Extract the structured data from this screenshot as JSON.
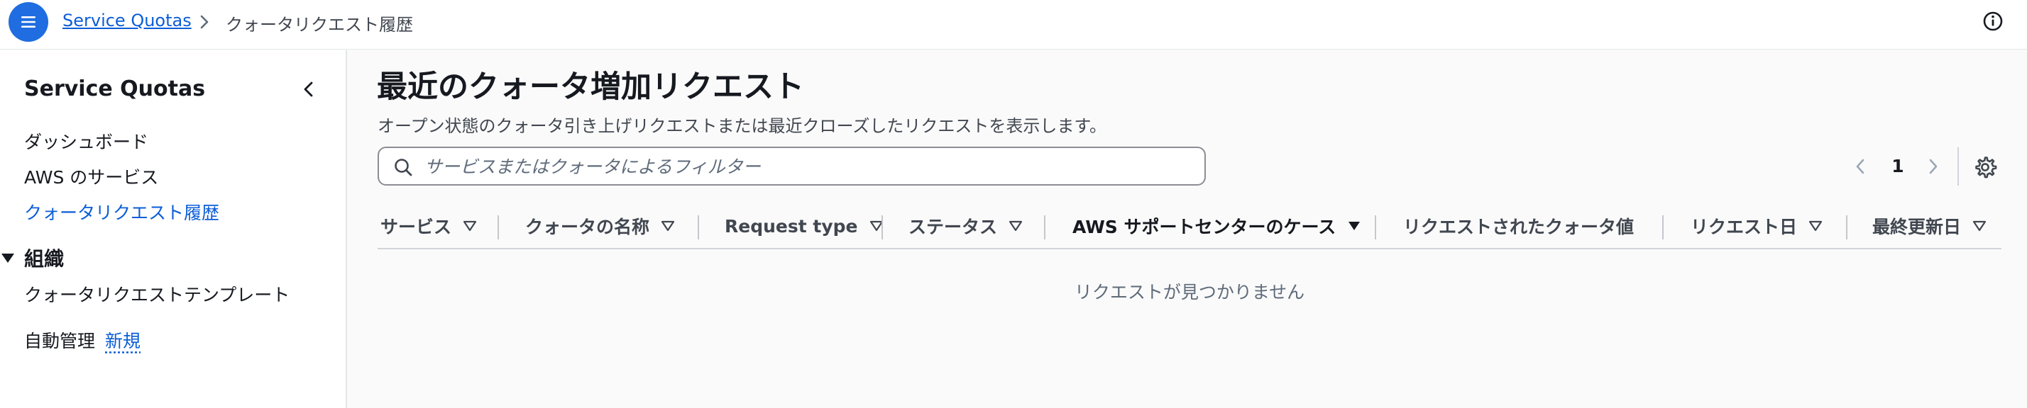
{
  "breadcrumb": {
    "root": "Service Quotas",
    "current": "クォータリクエスト履歴"
  },
  "sidebar": {
    "title": "Service Quotas",
    "items": [
      {
        "label": "ダッシュボード"
      },
      {
        "label": "AWS のサービス"
      },
      {
        "label": "クォータリクエスト履歴",
        "active": true
      }
    ],
    "group": {
      "label": "組織",
      "items": [
        {
          "label": "クォータリクエストテンプレート"
        },
        {
          "label": "自動管理",
          "badge": "新規"
        }
      ]
    }
  },
  "main": {
    "title": "最近のクォータ増加リクエスト",
    "description": "オープン状態のクォータ引き上げリクエストまたは最近クローズしたリクエストを表示します。",
    "search": {
      "placeholder": "サービスまたはクォータによるフィルター",
      "value": ""
    },
    "pagination": {
      "current_page": "1"
    },
    "table": {
      "columns": [
        {
          "label": "サービス"
        },
        {
          "label": "クォータの名称"
        },
        {
          "label": "Request type"
        },
        {
          "label": "ステータス"
        },
        {
          "label": "AWS サポートセンターのケース",
          "sorted": true
        },
        {
          "label": "リクエストされたクォータ値"
        },
        {
          "label": "リクエスト日"
        },
        {
          "label": "最終更新日"
        }
      ],
      "empty_message": "リクエストが見つかりません"
    }
  },
  "icons": {
    "menu": "hamburger-icon",
    "breadcrumb_separator": "chevron-right-icon",
    "info": "info-icon",
    "collapse": "chevron-left-icon",
    "group_toggle": "caret-down-icon",
    "search": "search-icon",
    "prev": "chevron-left-icon",
    "next": "chevron-right-icon",
    "settings": "gear-icon",
    "sort": "sort-caret-icon"
  },
  "colors": {
    "accent": "#0b5dd7",
    "menu_button": "#1f6de0",
    "text": "#16191f",
    "muted": "#5f6b7a"
  }
}
